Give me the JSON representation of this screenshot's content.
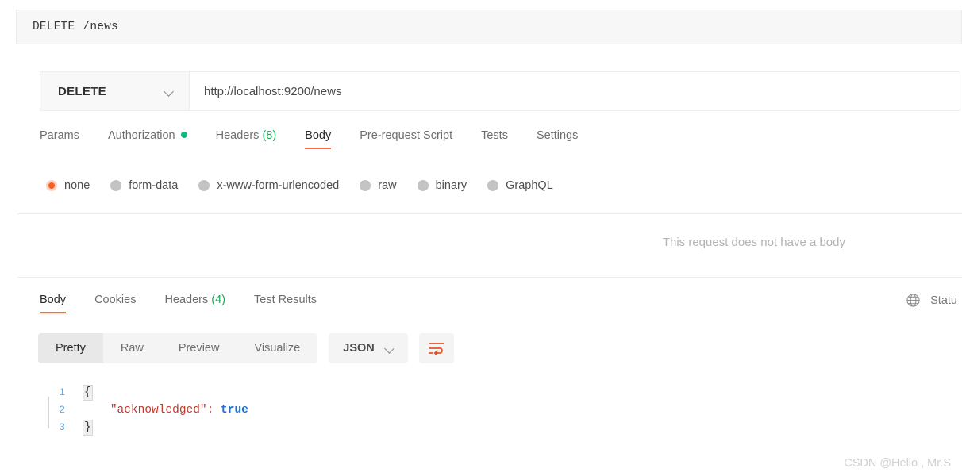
{
  "request_name_bar": {
    "method": "DELETE",
    "path": "/news"
  },
  "url_bar": {
    "method": "DELETE",
    "method_chevron_icon": "chevron-down-icon",
    "url": "http://localhost:9200/news"
  },
  "request_tabs": [
    {
      "label": "Params",
      "active": false,
      "dot": false,
      "count": ""
    },
    {
      "label": "Authorization",
      "active": false,
      "dot": true,
      "count": ""
    },
    {
      "label": "Headers",
      "active": false,
      "dot": false,
      "count": "(8)"
    },
    {
      "label": "Body",
      "active": true,
      "dot": false,
      "count": ""
    },
    {
      "label": "Pre-request Script",
      "active": false,
      "dot": false,
      "count": ""
    },
    {
      "label": "Tests",
      "active": false,
      "dot": false,
      "count": ""
    },
    {
      "label": "Settings",
      "active": false,
      "dot": false,
      "count": ""
    }
  ],
  "body_types": [
    {
      "label": "none",
      "selected": true
    },
    {
      "label": "form-data",
      "selected": false
    },
    {
      "label": "x-www-form-urlencoded",
      "selected": false
    },
    {
      "label": "raw",
      "selected": false
    },
    {
      "label": "binary",
      "selected": false
    },
    {
      "label": "GraphQL",
      "selected": false
    }
  ],
  "body_placeholder": "This request does not have a body",
  "response_tabs": [
    {
      "label": "Body",
      "active": true,
      "count": ""
    },
    {
      "label": "Cookies",
      "active": false,
      "count": ""
    },
    {
      "label": "Headers",
      "active": false,
      "count": "(4)"
    },
    {
      "label": "Test Results",
      "active": false,
      "count": ""
    }
  ],
  "response_status": {
    "globe_icon": "globe-icon",
    "label": "Statu"
  },
  "viewer": {
    "segments": [
      {
        "label": "Pretty",
        "active": true
      },
      {
        "label": "Raw",
        "active": false
      },
      {
        "label": "Preview",
        "active": false
      },
      {
        "label": "Visualize",
        "active": false
      }
    ],
    "format": "JSON",
    "format_chevron_icon": "chevron-down-icon",
    "wrap_icon": "wrap-lines-icon"
  },
  "code": {
    "lines": [
      {
        "number": "1",
        "open_brace": "{",
        "content": "",
        "value": ""
      },
      {
        "number": "2",
        "key": "\"acknowledged\":",
        "value": " true"
      },
      {
        "number": "3",
        "close_brace": "}"
      }
    ]
  },
  "watermark": "CSDN @Hello , Mr.S",
  "colors": {
    "accent": "#ff6c37",
    "green": "#1bab5b",
    "json_key": "#c0392b",
    "json_bool": "#1e6fd9"
  }
}
